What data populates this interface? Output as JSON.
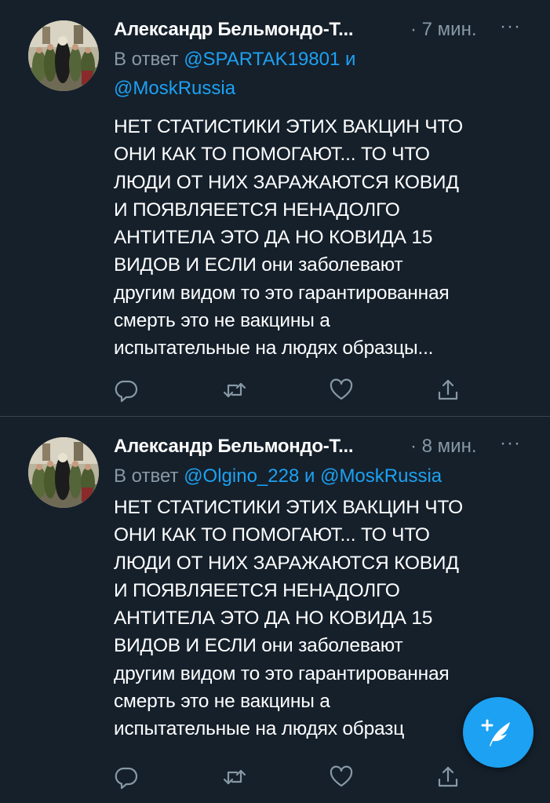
{
  "tweets": [
    {
      "author": "Александр Бельмондо-Т...",
      "time": "· 7 мин.",
      "more": "···",
      "reply_prefix": "В ответ",
      "reply_mention_1": "@SPARTAK19801",
      "reply_and": "и",
      "reply_mention_2": "@MoskRussia",
      "lines": [
        "НЕТ СТАТИСТИКИ ЭТИХ ВАКЦИН ЧТО",
        "ОНИ КАК ТО ПОМОГАЮТ... ТО ЧТО",
        "ЛЮДИ ОТ НИХ ЗАРАЖАЮТСЯ КОВИД",
        "И ПОЯВЛЯЕЕТСЯ НЕНАДОЛГО",
        "АНТИТЕЛА ЭТО ДА НО КОВИДА 15",
        "ВИДОВ И ЕСЛИ они заболевают",
        "другим видом то это гарантированная",
        "смерть это не вакцины а",
        "испытательные на людях образцы..."
      ]
    },
    {
      "author": "Александр Бельмондо-Т...",
      "time": "· 8 мин.",
      "more": "···",
      "reply_prefix": "В ответ",
      "reply_mention_1": "@Olgino_228",
      "reply_and": "и",
      "reply_mention_2": "@MoskRussia",
      "lines": [
        "НЕТ СТАТИСТИКИ ЭТИХ ВАКЦИН ЧТО",
        "ОНИ КАК ТО ПОМОГАЮТ... ТО ЧТО",
        "ЛЮДИ ОТ НИХ ЗАРАЖАЮТСЯ КОВИД",
        "И ПОЯВЛЯЕЕТСЯ НЕНАДОЛГО",
        "АНТИТЕЛА ЭТО ДА НО КОВИДА 15",
        "ВИДОВ И ЕСЛИ они заболевают",
        "другим видом то это гарантированная",
        "смерть это не вакцины а",
        "испытательные на людях образц"
      ]
    }
  ],
  "icons": [
    "reply-icon",
    "retweet-icon",
    "like-icon",
    "share-icon",
    "compose-tweet-icon"
  ],
  "colors": {
    "background": "#15202b",
    "secondary_text": "#8899a6",
    "link": "#1da1f2",
    "divider": "#38444d"
  }
}
